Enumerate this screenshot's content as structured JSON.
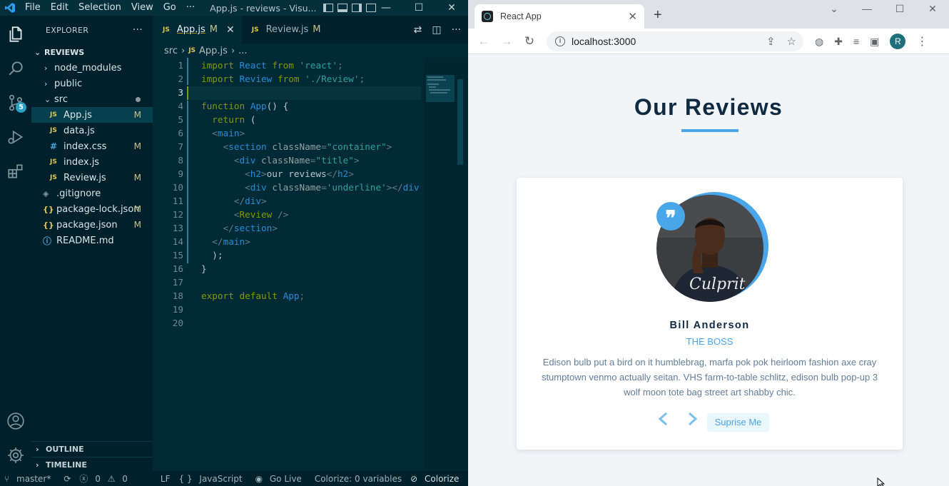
{
  "vscode": {
    "menu": [
      "File",
      "Edit",
      "Selection",
      "View",
      "Go",
      "···"
    ],
    "window_title": "App.js - reviews - Visu...",
    "explorer": {
      "title": "EXPLORER",
      "more": "···",
      "folder": "REVIEWS",
      "items": [
        {
          "label": "node_modules",
          "icon": "chevron-right",
          "status": ""
        },
        {
          "label": "public",
          "icon": "chevron-right",
          "status": ""
        },
        {
          "label": "src",
          "icon": "chevron-down",
          "status": "dot"
        },
        {
          "label": "App.js",
          "icon": "JS",
          "status": "M"
        },
        {
          "label": "data.js",
          "icon": "JS",
          "status": ""
        },
        {
          "label": "index.css",
          "icon": "#",
          "status": "M"
        },
        {
          "label": "index.js",
          "icon": "JS",
          "status": ""
        },
        {
          "label": "Review.js",
          "icon": "JS",
          "status": "M"
        },
        {
          "label": ".gitignore",
          "icon": "git",
          "status": ""
        },
        {
          "label": "package-lock.json",
          "icon": "{}",
          "status": "M"
        },
        {
          "label": "package.json",
          "icon": "{}",
          "status": "M"
        },
        {
          "label": "README.md",
          "icon": "info",
          "status": ""
        }
      ],
      "outline": "OUTLINE",
      "timeline": "TIMELINE"
    },
    "source_control_badge": "5",
    "tabs": [
      {
        "label": "App.js",
        "status": "M",
        "close": "✕"
      },
      {
        "label": "Review.js",
        "status": "M"
      }
    ],
    "breadcrumb": [
      "src",
      "App.js",
      "..."
    ],
    "line_numbers": [
      "1",
      "2",
      "3",
      "4",
      "5",
      "6",
      "7",
      "8",
      "9",
      "10",
      "11",
      "12",
      "13",
      "14",
      "15",
      "16",
      "17",
      "18",
      "19",
      "20"
    ],
    "status_bar": {
      "branch": "master*",
      "errors": "0",
      "warnings": "0",
      "eol": "LF",
      "language": "JavaScript",
      "live": "Go Live",
      "colorize_vars": "Colorize: 0 variables",
      "colorize": "Colorize"
    }
  },
  "browser": {
    "tab_title": "React App",
    "tab_close": "✕",
    "new_tab": "+",
    "url": "localhost:3000",
    "profile_initial": "R"
  },
  "app": {
    "title": "Our Reviews",
    "review": {
      "name": "Bill Anderson",
      "job": "the boss",
      "text": "Edison bulb put a bird on it humblebrag, marfa pok pok heirloom fashion axe cray stumptown venmo actually seitan. VHS farm-to-table schlitz, edison bulb pop-up 3 wolf moon tote bag street art shabby chic."
    },
    "prev": "‹",
    "next": "›",
    "random_button": "Suprise Me",
    "quote_glyph": "❞"
  },
  "colors": {
    "accent": "#49a6e9",
    "heading": "#102a42",
    "vscode_bg": "#002b36"
  }
}
